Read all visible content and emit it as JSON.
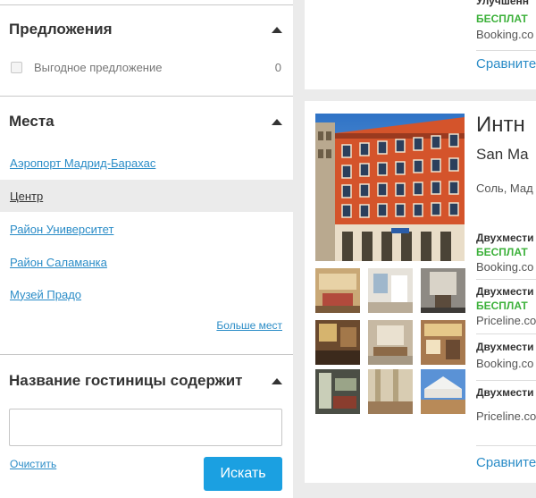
{
  "filters": {
    "offers": {
      "title": "Предложения",
      "items": [
        {
          "label": "Выгодное предложение",
          "count": "0"
        }
      ]
    },
    "places": {
      "title": "Места",
      "items": [
        {
          "label": "Аэропорт Мадрид-Барахас"
        },
        {
          "label": "Центр"
        },
        {
          "label": "Район Университет"
        },
        {
          "label": "Район Саламанка"
        },
        {
          "label": "Музей Прадо"
        }
      ],
      "more_label": "Больше мест"
    },
    "hotel_name": {
      "title": "Название гостиницы содержит",
      "input_value": "",
      "clear_label": "Очистить",
      "search_label": "Искать"
    }
  },
  "results": {
    "card1": {
      "offer_name": "Улучшенн",
      "free_label": "БЕСПЛАТ",
      "site": "Booking.co",
      "compare_label": "Сравните"
    },
    "card2": {
      "hotel_name": "Интн",
      "hotel_sub": "San Ma",
      "location": "Соль, Мад",
      "offers": [
        {
          "name": "Двухмести",
          "free": "БЕСПЛАТ",
          "site": "Booking.co"
        },
        {
          "name": "Двухмести",
          "free": "БЕСПЛАТ",
          "site": "Priceline.co"
        },
        {
          "name": "Двухмести",
          "free": "",
          "site": "Booking.co"
        },
        {
          "name": "Двухмести",
          "free": "",
          "site": "Priceline.co"
        }
      ],
      "compare_label": "Сравните"
    }
  },
  "colors": {
    "link": "#2a8cc7",
    "free": "#3db13b",
    "button": "#1ba0e1",
    "page_bg": "#ebebeb"
  }
}
